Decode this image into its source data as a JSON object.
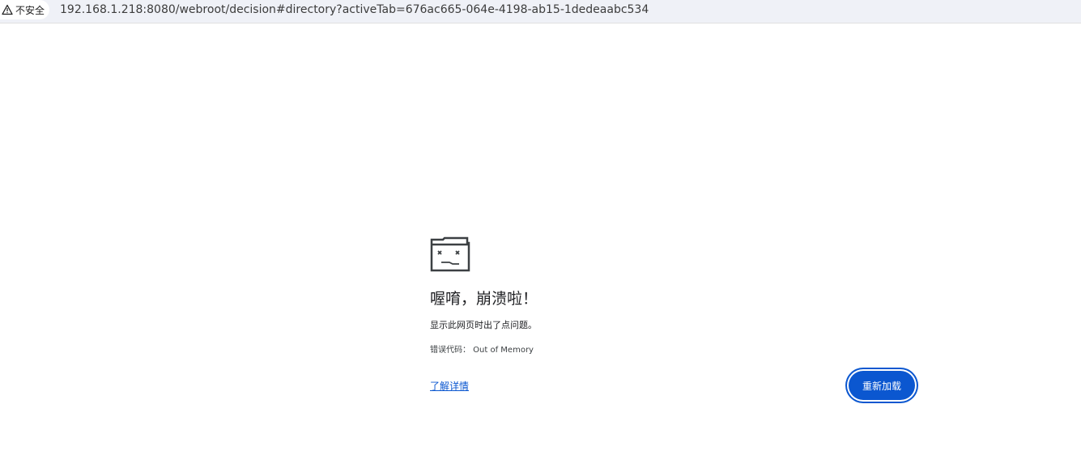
{
  "address_bar": {
    "security_label": "不安全",
    "url": "192.168.1.218:8080/webroot/decision#directory?activeTab=676ac665-064e-4198-ab15-1dedeaabc534"
  },
  "error_page": {
    "icon": "sad-folder-icon",
    "title": "喔唷，崩溃啦！",
    "description": "显示此网页时出了点问题。",
    "error_code": "错误代码：  Out of Memory",
    "learn_more_label": "了解详情",
    "reload_label": "重新加载"
  },
  "colors": {
    "accent": "#0b57d0",
    "address_bar_bg": "#eff1f7",
    "text": "#202124"
  }
}
